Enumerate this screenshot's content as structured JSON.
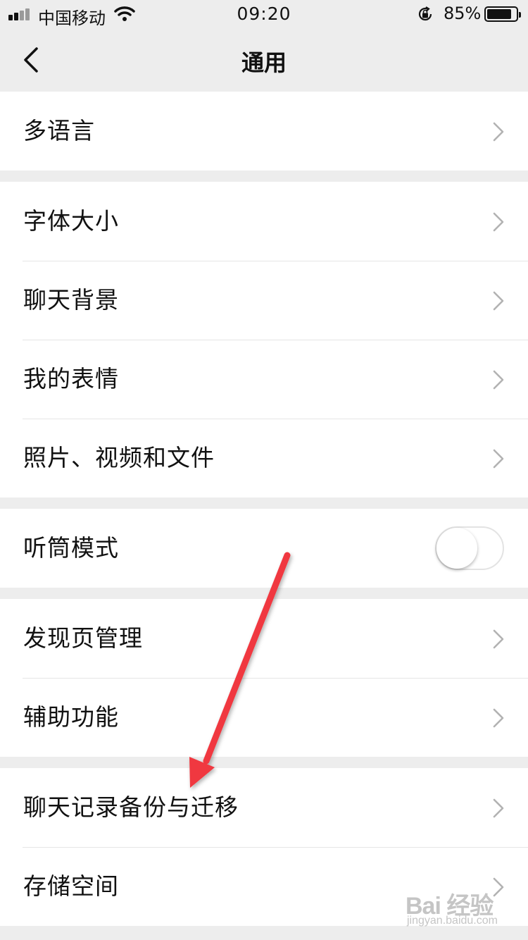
{
  "status_bar": {
    "carrier": "中国移动",
    "time": "09:20",
    "battery_text": "85%",
    "battery_level": 0.85
  },
  "nav": {
    "title": "通用",
    "back_icon": "chevron-left-icon"
  },
  "groups": [
    {
      "items": [
        {
          "label": "多语言"
        }
      ]
    },
    {
      "items": [
        {
          "label": "字体大小"
        },
        {
          "label": "聊天背景"
        },
        {
          "label": "我的表情"
        },
        {
          "label": "照片、视频和文件"
        }
      ]
    },
    {
      "items": [
        {
          "label": "听筒模式",
          "toggle": false
        }
      ]
    },
    {
      "items": [
        {
          "label": "发现页管理"
        },
        {
          "label": "辅助功能"
        }
      ]
    },
    {
      "items": [
        {
          "label": "聊天记录备份与迁移"
        },
        {
          "label": "存储空间"
        }
      ]
    }
  ],
  "annotation": {
    "color": "#f0373f",
    "icon": "arrow-annotation"
  },
  "watermark": {
    "logo": "Bai 经验",
    "site": "jingyan.baidu.com"
  }
}
